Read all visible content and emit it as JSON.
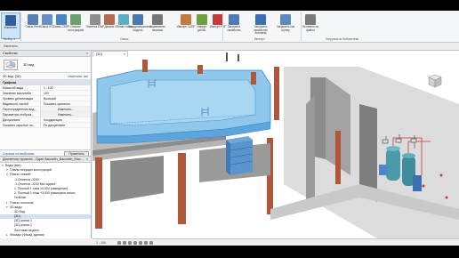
{
  "ribbon": {
    "buttons": [
      {
        "label": "Изменить",
        "color": "#2e5e9e"
      },
      {
        "label": "Связь Revit",
        "color": "#5a7fb5"
      },
      {
        "label": "Связь IFC",
        "color": "#6a8fc5"
      },
      {
        "label": "Связь САПР",
        "color": "#4b84c4"
      },
      {
        "label": "Связать топографию",
        "color": "#6ba16b"
      },
      {
        "label": "Пометка DWF",
        "color": "#8e8e8e"
      },
      {
        "label": "Декаль",
        "color": "#b46b4e"
      },
      {
        "label": "Облако точек",
        "color": "#5bb0c8"
      },
      {
        "label": "Координационная модель",
        "color": "#4a78b0"
      },
      {
        "label": "Управление связями",
        "color": "#777777"
      },
      {
        "label": "Импорт САПР",
        "color": "#c47b3a"
      },
      {
        "label": "Импорт gbXML",
        "color": "#6f9f3f"
      },
      {
        "label": "Импорт PDF",
        "color": "#c43a3a"
      },
      {
        "label": "Загрузить семейство",
        "color": "#4e7ab8"
      },
      {
        "label": "Загрузить семейство Autodesk",
        "color": "#3a6fb0"
      },
      {
        "label": "Загрузить как группу",
        "color": "#5e88c0"
      },
      {
        "label": "Вставить из файла",
        "color": "#7a7a7a"
      }
    ],
    "panels": {
      "select": "Выбор ▾",
      "links": "Связь",
      "import": "Импорт",
      "library": "Загрузка из библиотеки"
    }
  },
  "optbar": {
    "left": "Изменить",
    "mid": ""
  },
  "properties": {
    "title": "Свойства",
    "close": "×",
    "type_name": "3D вид",
    "instance": "3D вид: {3D}",
    "edit_type": "Изменить тип",
    "groups": [
      {
        "name": "Графика",
        "rows": [
          {
            "k": "Масштаб вида",
            "v": "1 : 100",
            "btn": false
          },
          {
            "k": "Значение масштаба",
            "v": "100",
            "btn": false
          },
          {
            "k": "Уровень детализации",
            "v": "Высокий",
            "btn": false
          },
          {
            "k": "Видимость частей",
            "v": "Показать оригинал",
            "btn": false
          },
          {
            "k": "Переопределения вид...",
            "v": "Изменить...",
            "btn": true
          },
          {
            "k": "Параметры отображ...",
            "v": "Изменить...",
            "btn": true
          },
          {
            "k": "Дисциплина",
            "v": "Координация",
            "btn": false
          },
          {
            "k": "Показать скрытые ли...",
            "v": "По дисциплине",
            "btn": false
          }
        ]
      }
    ],
    "help": "Справка по свойствам",
    "apply": "Применить"
  },
  "browser": {
    "title": "Диспетчер проекта - Один бассейн_Бассейн_Мас...",
    "close": "×",
    "nodes": [
      {
        "label": "Виды (все)",
        "level": 0,
        "arrow": "▾",
        "selected": false
      },
      {
        "label": "Планы несущих конструкций",
        "level": 1,
        "arrow": "▾",
        "selected": false
      },
      {
        "label": "Планы этажей",
        "level": 1,
        "arrow": "▾",
        "selected": false
      },
      {
        "label": "-1.Отметка -3200",
        "level": 2,
        "arrow": "",
        "selected": false
      },
      {
        "label": "-1.Отметка -3200 без заднее",
        "level": 2,
        "arrow": "",
        "selected": false
      },
      {
        "label": "1. Полный 1 этаж ±0,000 (заведение)",
        "level": 2,
        "arrow": "",
        "selected": false
      },
      {
        "label": "2. Полный 2 этаж +3,000 разморзка сиили",
        "level": 2,
        "arrow": "",
        "selected": false
      },
      {
        "label": "Генплан",
        "level": 2,
        "arrow": "",
        "selected": false
      },
      {
        "label": "Планы потолков",
        "level": 1,
        "arrow": "▸",
        "selected": false
      },
      {
        "label": "3D виды",
        "level": 1,
        "arrow": "▾",
        "selected": false
      },
      {
        "label": "3D Вид",
        "level": 2,
        "arrow": "",
        "selected": false
      },
      {
        "label": "{3D}",
        "level": 2,
        "arrow": "",
        "selected": true
      },
      {
        "label": "{3D} копия 1",
        "level": 2,
        "arrow": "",
        "selected": false
      },
      {
        "label": "{3D} копия 2",
        "level": 2,
        "arrow": "",
        "selected": false
      },
      {
        "label": "Листовая модель",
        "level": 2,
        "arrow": "",
        "selected": false
      },
      {
        "label": "Фасады (Фасад здания)",
        "level": 1,
        "arrow": "▸",
        "selected": false
      }
    ]
  },
  "viewport": {
    "tab": "{3D}",
    "tab_close": "×",
    "scale": "1 : 100"
  },
  "colors": {
    "pool": "#8fc8ea",
    "pool_edge": "#3a84c8",
    "column": "#b0573a",
    "wall": "#8c8c8c",
    "tank": "#4a9aa8"
  }
}
